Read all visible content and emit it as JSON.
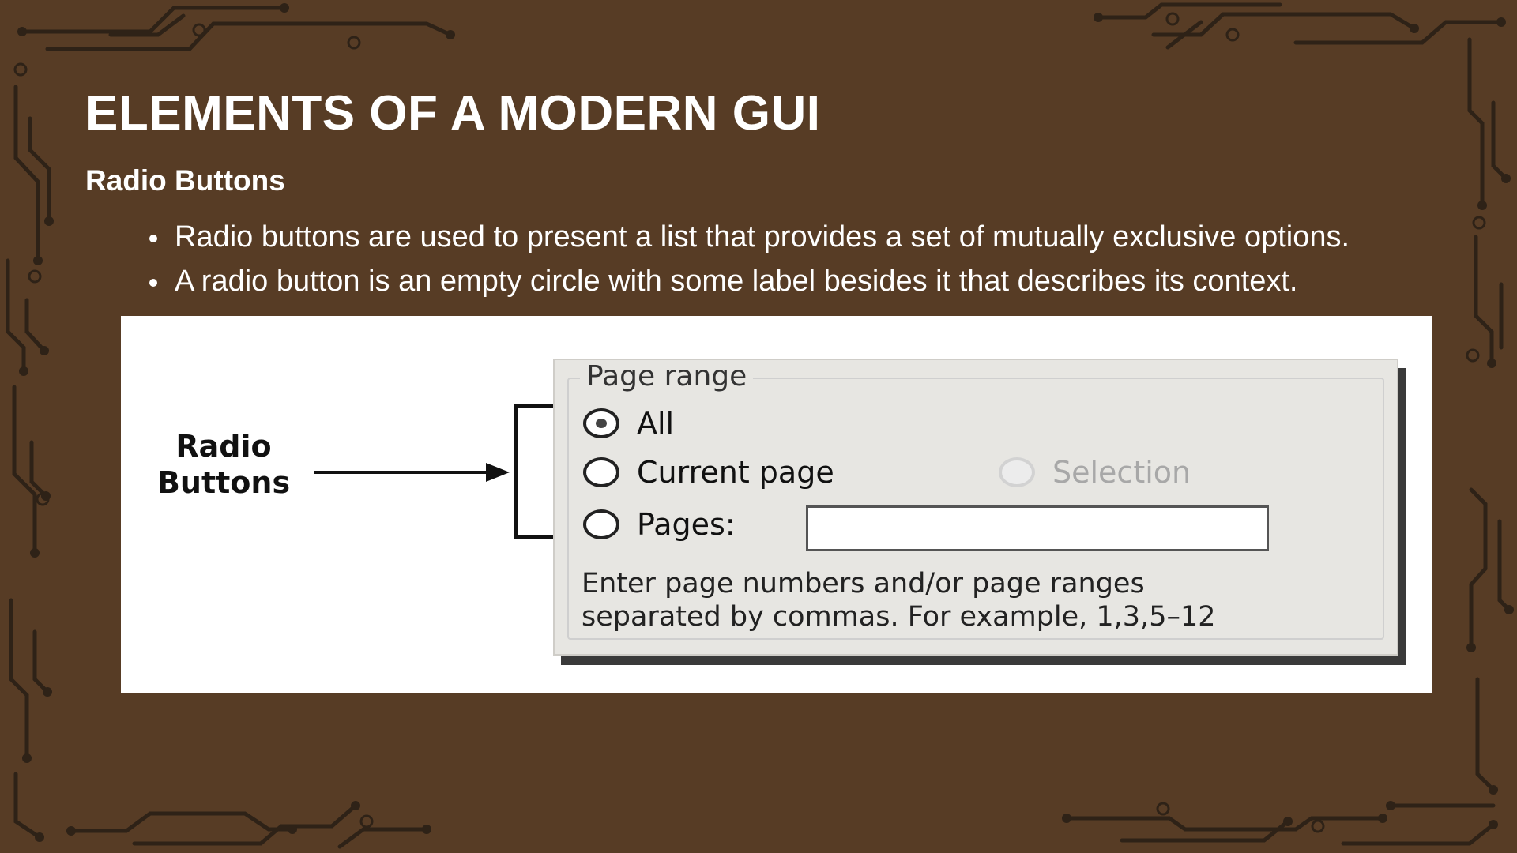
{
  "slide": {
    "title": "ELEMENTS OF A MODERN GUI",
    "subtitle": "Radio Buttons",
    "bullets": [
      "Radio buttons are used to present a list that provides a set of mutually exclusive options.",
      "A radio button is an empty circle with some label besides it that describes its context."
    ]
  },
  "figure": {
    "annotation_label": "Radio\nButtons",
    "page_range_group": {
      "legend": "Page range",
      "options": [
        {
          "label": "All",
          "selected": true,
          "enabled": true
        },
        {
          "label": "Current page",
          "selected": false,
          "enabled": true
        },
        {
          "label": "Selection",
          "selected": false,
          "enabled": false
        },
        {
          "label": "Pages:",
          "selected": false,
          "enabled": true
        }
      ],
      "pages_input_value": "",
      "help_text": "Enter page numbers and/or page ranges\nseparated by commas.  For example, 1,3,5–12"
    }
  },
  "colors": {
    "background": "#573c25",
    "circuit_lines": "#2e2217",
    "text": "#ffffff"
  }
}
